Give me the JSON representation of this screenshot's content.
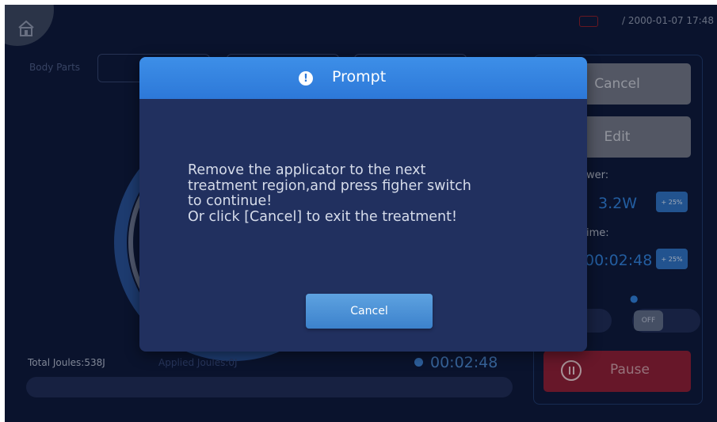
{
  "status_bar": {
    "datetime": "/ 2000-01-07 17:48"
  },
  "body_parts": {
    "label": "Body Parts"
  },
  "bottom": {
    "total_joules": "Total Joules:538J",
    "applied_joules": "Applied Joules:0J",
    "timer": "00:02:48",
    "progress": 0
  },
  "right_panel": {
    "cancel_label": "Cancel",
    "edit_label": "Edit",
    "power_label": "wer:",
    "power_value": "3.2W",
    "power_plus": "+ 25%",
    "time_label": "ime:",
    "time_value": "00:02:48",
    "time_plus": "+ 25%",
    "sound_toggle": "OFF",
    "pause_label": "Pause"
  },
  "dialog": {
    "title": "Prompt",
    "message_lines": [
      "Remove the applicator to the next",
      "treatment region,and press figher switch",
      "to continue!",
      "Or click [Cancel] to exit the treatment!"
    ],
    "cancel_label": "Cancel"
  },
  "colors": {
    "background": "#0e1a3c",
    "dialog_header": "#2d78d8",
    "dialog_body": "#21305f",
    "accent_blue": "#2f7dd6",
    "pause_red": "#8a1f37"
  },
  "icons": [
    "home-icon",
    "battery-icon",
    "exclamation-icon",
    "clock-icon",
    "speaker-icon",
    "pause-icon"
  ]
}
